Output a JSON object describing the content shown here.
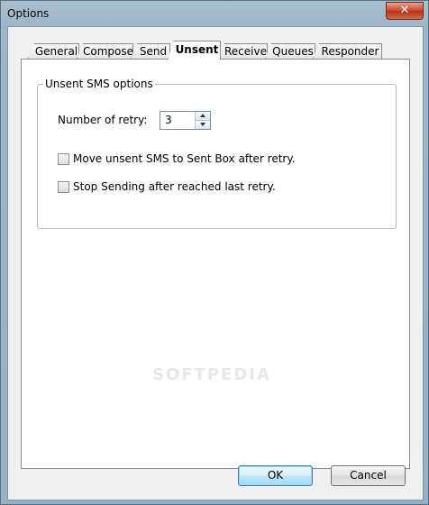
{
  "window": {
    "title": "Options",
    "close_label": "✕"
  },
  "tabs": [
    {
      "label": "General",
      "active": false
    },
    {
      "label": "Compose",
      "active": false
    },
    {
      "label": "Send",
      "active": false
    },
    {
      "label": "Unsent",
      "active": true
    },
    {
      "label": "Receive",
      "active": false
    },
    {
      "label": "Queues",
      "active": false
    },
    {
      "label": "Responder",
      "active": false
    }
  ],
  "group": {
    "title": "Unsent SMS options",
    "retry_label": "Number of retry:",
    "retry_value": "3",
    "move_label": "Move unsent SMS to Sent Box after retry.",
    "move_checked": false,
    "stop_label": "Stop Sending after reached last retry.",
    "stop_checked": false
  },
  "buttons": {
    "ok": "OK",
    "cancel": "Cancel"
  },
  "watermark": "SOFTPEDIA"
}
